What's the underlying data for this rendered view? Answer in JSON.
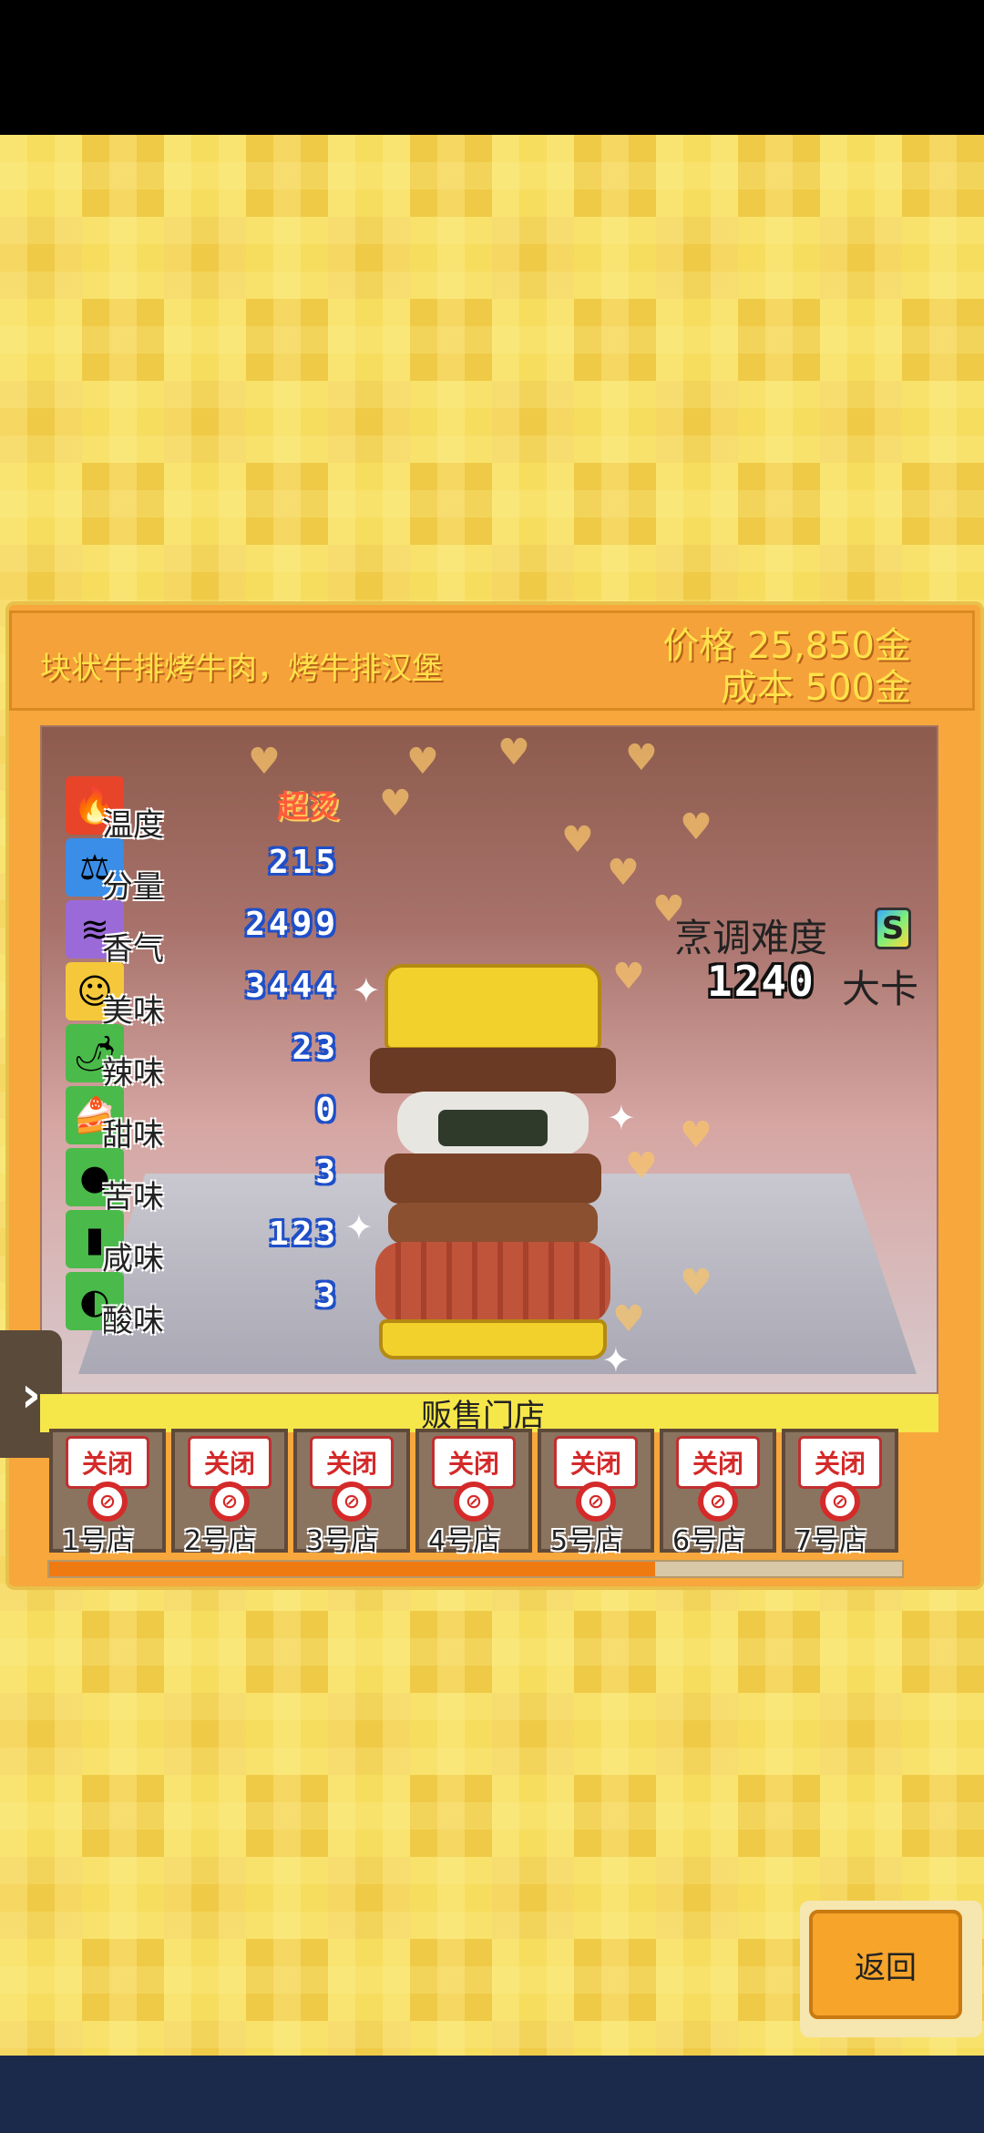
{
  "dish": {
    "name": "块状牛排烤牛肉，烤牛排汉堡",
    "price": "价格 25,850金",
    "cost": "成本 500金"
  },
  "stats": [
    {
      "label": "温度",
      "value": "超烫",
      "icon": "flame-icon",
      "color": "#e8442a"
    },
    {
      "label": "分量",
      "value": "215",
      "icon": "scale-icon",
      "color": "#3a8ee8"
    },
    {
      "label": "香气",
      "value": "2499",
      "icon": "aroma-icon",
      "color": "#9a6ad8"
    },
    {
      "label": "美味",
      "value": "3444",
      "icon": "smiley-icon",
      "color": "#f4c83a"
    },
    {
      "label": "辣味",
      "value": "23",
      "icon": "chili-icon",
      "color": "#4aba4a"
    },
    {
      "label": "甜味",
      "value": "0",
      "icon": "cake-icon",
      "color": "#4aba4a"
    },
    {
      "label": "苦味",
      "value": "3",
      "icon": "bitter-melon-icon",
      "color": "#4aba4a"
    },
    {
      "label": "咸味",
      "value": "123",
      "icon": "salt-icon",
      "color": "#4aba4a"
    },
    {
      "label": "酸味",
      "value": "3",
      "icon": "lemon-icon",
      "color": "#4aba4a"
    }
  ],
  "cooking": {
    "difficulty_label": "烹调难度",
    "difficulty_rank": "S",
    "calories": "1240",
    "calorie_unit": "大卡"
  },
  "shops": {
    "title": "贩售门店",
    "closed_label": "关闭",
    "items": [
      "1号店",
      "2号店",
      "3号店",
      "4号店",
      "5号店",
      "6号店",
      "7号店"
    ],
    "progress": 0.71
  },
  "buttons": {
    "back": "返回",
    "side_tab": "›"
  },
  "colors": {
    "panel": "#f7a73c",
    "title_text": "#ffe24a",
    "progress": "#f07a12",
    "back_button": "#f6a42a"
  }
}
